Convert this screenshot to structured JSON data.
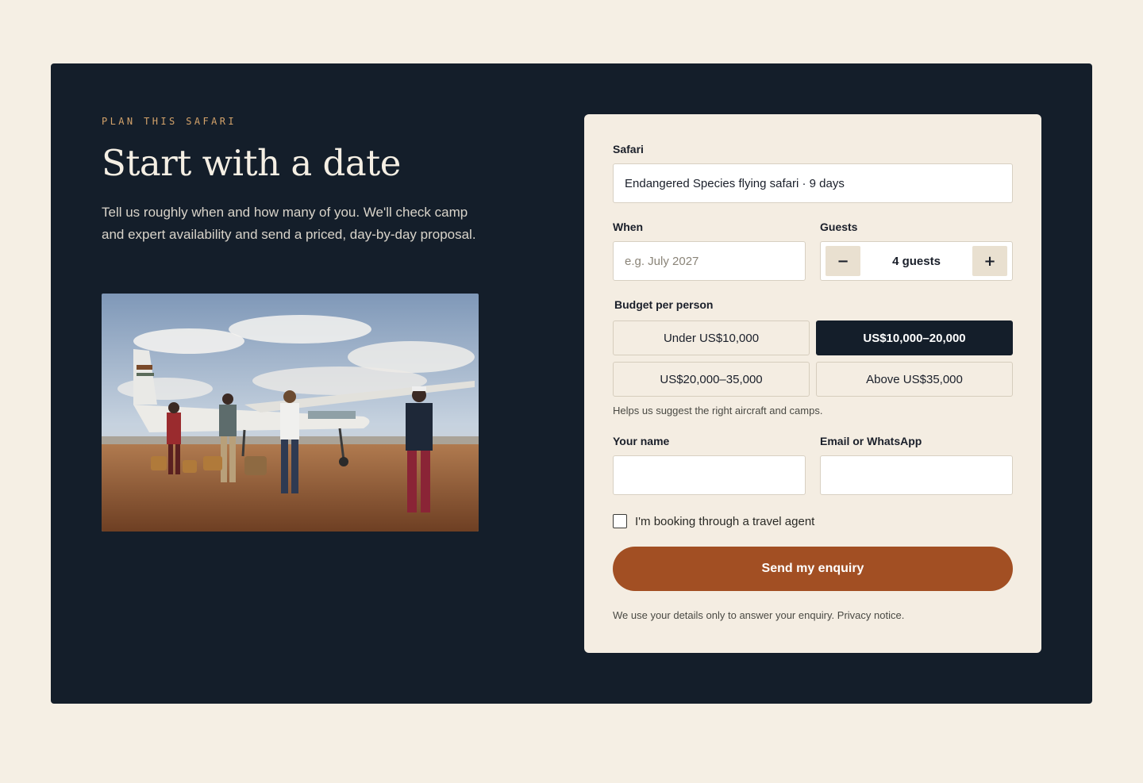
{
  "hero": {
    "eyebrow": "PLAN THIS SAFARI",
    "title": "Start with a date",
    "intro": "Tell us roughly when and how many of you. We'll check camp and expert availability and send a priced, day-by-day proposal."
  },
  "form": {
    "safari": {
      "label": "Safari",
      "value": "Endangered Species flying safari · 9 days"
    },
    "when": {
      "label": "When",
      "value": "",
      "placeholder": "e.g. July 2027"
    },
    "guests": {
      "label": "Guests",
      "minus": "−",
      "plus": "+",
      "value": "4 guests"
    },
    "budget": {
      "label": "Budget per person",
      "options": [
        {
          "label": "Under US$10,000",
          "selected": false
        },
        {
          "label": "US$10,000–20,000",
          "selected": true
        },
        {
          "label": "US$20,000–35,000",
          "selected": false
        },
        {
          "label": "Above US$35,000",
          "selected": false
        }
      ],
      "hint": "Helps us suggest the right aircraft and camps."
    },
    "name": {
      "label": "Your name",
      "value": ""
    },
    "contact": {
      "label": "Email or WhatsApp",
      "value": ""
    },
    "agent": {
      "label": "I'm booking through a travel agent",
      "checked": false
    },
    "submit_label": "Send my enquiry",
    "privacy": "We use your details only to answer your enquiry. Privacy notice."
  },
  "colors": {
    "page_bg": "#f5efe4",
    "panel_bg": "#141e2a",
    "card_bg": "#f4ede2",
    "accent": "#a24f23",
    "eyebrow": "#d3a26a"
  }
}
